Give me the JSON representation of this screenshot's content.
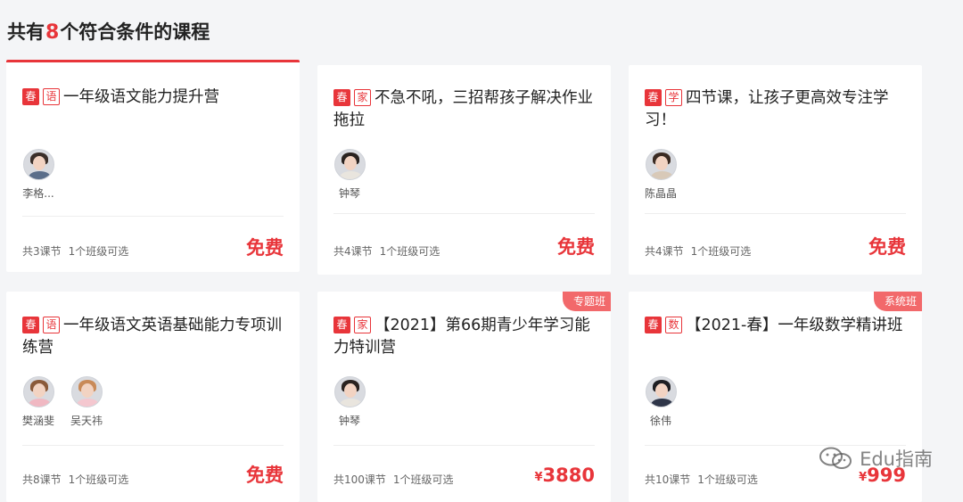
{
  "header": {
    "prefix": "共有",
    "count": "8",
    "suffix": "个符合条件的课程"
  },
  "courses": [
    {
      "tag1": "春",
      "tag2": "语",
      "title": "一年级语文能力提升营",
      "teachers": [
        {
          "name": "李格..."
        }
      ],
      "lessons": "共3课节",
      "classes": "1个班级可选",
      "price": "免费",
      "price_currency": "",
      "badge": ""
    },
    {
      "tag1": "春",
      "tag2": "家",
      "title": "不急不吼，三招帮孩子解决作业拖拉",
      "teachers": [
        {
          "name": "钟琴"
        }
      ],
      "lessons": "共4课节",
      "classes": "1个班级可选",
      "price": "免费",
      "price_currency": "",
      "badge": ""
    },
    {
      "tag1": "春",
      "tag2": "学",
      "title": "四节课，让孩子更高效专注学习！",
      "teachers": [
        {
          "name": "陈晶晶"
        }
      ],
      "lessons": "共4课节",
      "classes": "1个班级可选",
      "price": "免费",
      "price_currency": "",
      "badge": ""
    },
    {
      "tag1": "春",
      "tag2": "语",
      "title": "一年级语文英语基础能力专项训练营",
      "teachers": [
        {
          "name": "樊涵斐"
        },
        {
          "name": "吴天祎"
        }
      ],
      "lessons": "共8课节",
      "classes": "1个班级可选",
      "price": "免费",
      "price_currency": "",
      "badge": ""
    },
    {
      "tag1": "春",
      "tag2": "家",
      "title": "【2021】第66期青少年学习能力特训营",
      "teachers": [
        {
          "name": "钟琴"
        }
      ],
      "lessons": "共100课节",
      "classes": "1个班级可选",
      "price": "3880",
      "price_currency": "¥",
      "badge": "专题班"
    },
    {
      "tag1": "春",
      "tag2": "数",
      "title": "【2021-春】一年级数学精讲班",
      "teachers": [
        {
          "name": "徐伟"
        }
      ],
      "lessons": "共10课节",
      "classes": "1个班级可选",
      "price": "999",
      "price_currency": "¥",
      "badge": "系统班"
    }
  ],
  "watermark": {
    "text": "Edu指南"
  },
  "colors": {
    "accent": "#e8353a",
    "badge": "#f2696b",
    "background": "#f4f5f7"
  }
}
